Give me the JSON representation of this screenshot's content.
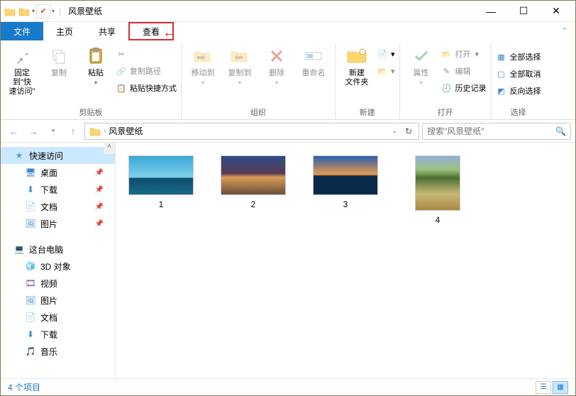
{
  "title": "风景壁纸",
  "tabs": {
    "file": "文件",
    "home": "主页",
    "share": "共享",
    "view": "查看"
  },
  "ribbon": {
    "clipboard": {
      "pin": "固定到\"快\n速访问\"",
      "copy": "复制",
      "paste": "粘贴",
      "copy_path": "复制路径",
      "paste_shortcut": "粘贴快捷方式",
      "label": "剪贴板"
    },
    "organize": {
      "move_to": "移动到",
      "copy_to": "复制到",
      "delete": "删除",
      "rename": "重命名",
      "label": "组织"
    },
    "new": {
      "new_folder": "新建\n文件夹",
      "label": "新建"
    },
    "open": {
      "properties": "属性",
      "open": "打开",
      "edit": "编辑",
      "history": "历史记录",
      "label": "打开"
    },
    "select": {
      "select_all": "全部选择",
      "select_none": "全部取消",
      "invert": "反向选择",
      "label": "选择"
    }
  },
  "breadcrumb": {
    "folder": "风景壁纸"
  },
  "search": {
    "placeholder": "搜索\"风景壁纸\""
  },
  "sidebar": {
    "quick": "快速访问",
    "desktop": "桌面",
    "downloads": "下载",
    "documents": "文档",
    "pictures": "图片",
    "thispc": "这台电脑",
    "objects3d": "3D 对象",
    "videos": "视频",
    "pictures2": "图片",
    "documents2": "文档",
    "downloads2": "下载",
    "music": "音乐"
  },
  "files": [
    {
      "name": "1",
      "gradient": "linear-gradient(to bottom,#3ba6d8 0%,#7fd0ea 55%,#0f4f6f 58%,#1a6a8a 100%)"
    },
    {
      "name": "2",
      "gradient": "linear-gradient(to bottom,#2a4c84 0%,#5a3a55 45%,#d99b55 55%,#6a4e3d 100%)"
    },
    {
      "name": "3",
      "gradient": "linear-gradient(to bottom,#2a5fb0 0%,#e89b4a 48%,#0a2a4a 52%,#0a2a4a 100%)"
    },
    {
      "name": "4",
      "gradient": "linear-gradient(to bottom,#8fb0d8 0%,#9ec080 25%,#4a7030 40%,#c8b878 70%,#a88840 100%)"
    }
  ],
  "status": {
    "count": "4 个项目"
  }
}
